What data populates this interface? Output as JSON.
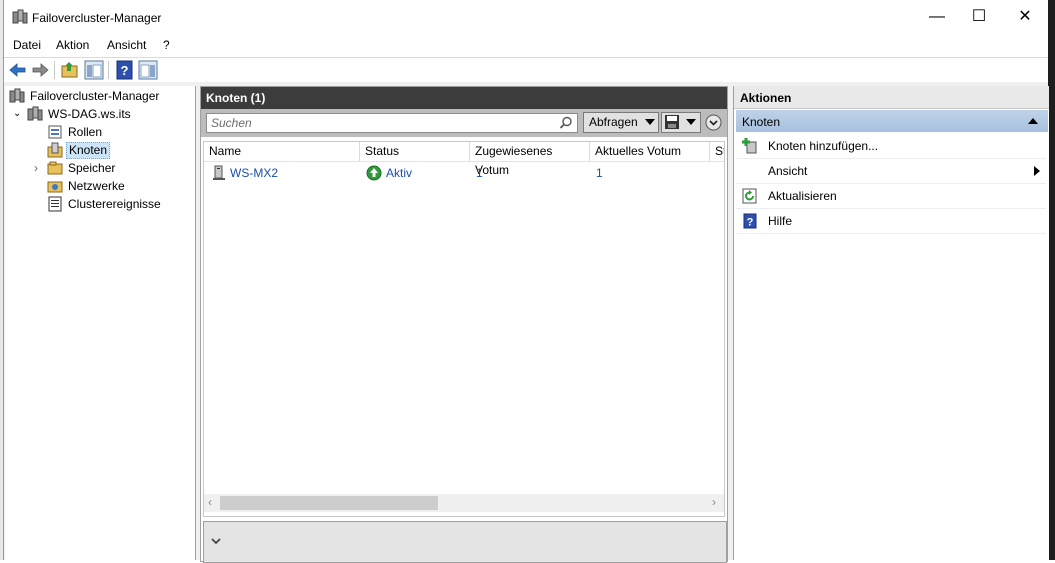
{
  "window": {
    "title": "Failovercluster-Manager",
    "minimize_glyph": "—",
    "maximize_glyph": "☐",
    "close_glyph": "✕"
  },
  "menu": [
    "Datei",
    "Aktion",
    "Ansicht",
    "?"
  ],
  "toolbar": {
    "icons": [
      "back-arrow-icon",
      "forward-arrow-icon",
      "up-folder-icon",
      "show-hide-tree-icon",
      "help-icon",
      "show-hide-action-pane-icon"
    ]
  },
  "tree": {
    "root": "Failovercluster-Manager",
    "cluster": "WS-DAG.ws.its",
    "items": [
      "Rollen",
      "Knoten",
      "Speicher",
      "Netzwerke",
      "Clusterereignisse"
    ],
    "selected": "Knoten"
  },
  "center": {
    "title": "Knoten (1)",
    "search_placeholder": "Suchen",
    "query_button": "Abfragen",
    "columns": [
      "Name",
      "Status",
      "Zugewiesenes Votum",
      "Aktuelles Votum",
      "St"
    ],
    "rows": [
      {
        "name": "WS-MX2",
        "status": "Aktiv",
        "assigned_vote": "1",
        "current_vote": "1"
      }
    ]
  },
  "actions": {
    "title": "Aktionen",
    "section": "Knoten",
    "items": [
      "Knoten hinzufügen...",
      "Ansicht",
      "Aktualisieren",
      "Hilfe"
    ]
  },
  "colors": {
    "center_header": "#3c3c3c",
    "actions_section": "#b4c9e3",
    "link_blue": "#1a4fa8",
    "status_green": "#2e9b3a"
  }
}
